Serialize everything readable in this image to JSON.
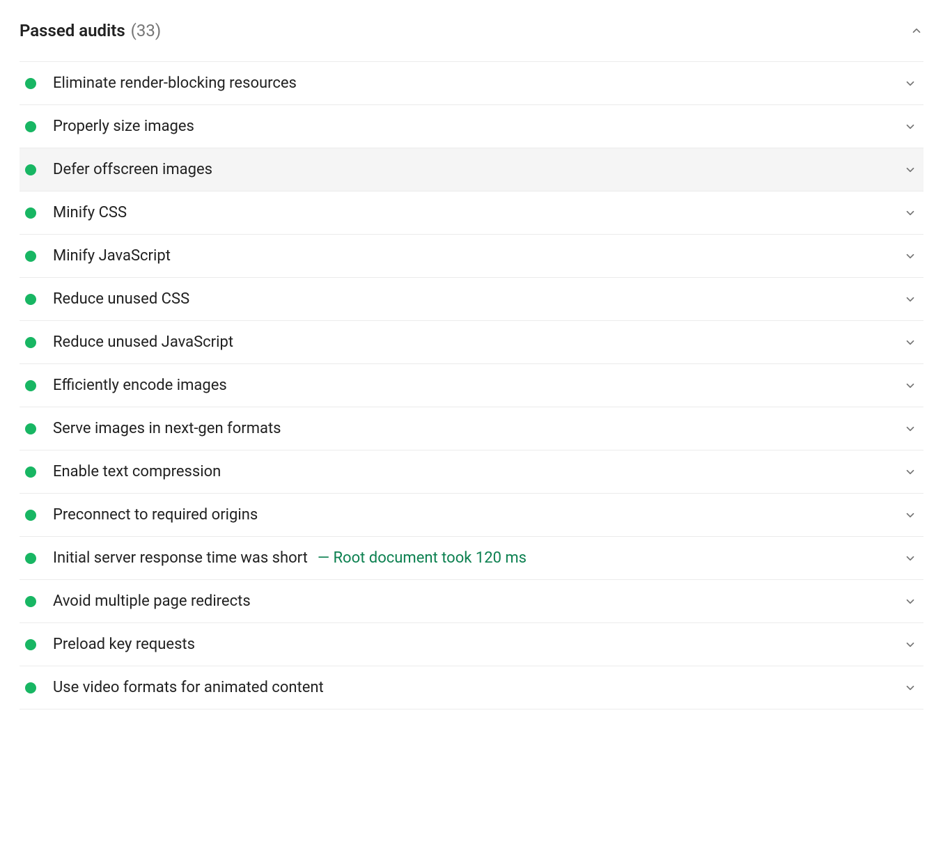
{
  "header": {
    "title": "Passed audits",
    "count": "(33)"
  },
  "audits": [
    {
      "label": "Eliminate render-blocking resources",
      "detail": "",
      "highlighted": false
    },
    {
      "label": "Properly size images",
      "detail": "",
      "highlighted": false
    },
    {
      "label": "Defer offscreen images",
      "detail": "",
      "highlighted": true
    },
    {
      "label": "Minify CSS",
      "detail": "",
      "highlighted": false
    },
    {
      "label": "Minify JavaScript",
      "detail": "",
      "highlighted": false
    },
    {
      "label": "Reduce unused CSS",
      "detail": "",
      "highlighted": false
    },
    {
      "label": "Reduce unused JavaScript",
      "detail": "",
      "highlighted": false
    },
    {
      "label": "Efficiently encode images",
      "detail": "",
      "highlighted": false
    },
    {
      "label": "Serve images in next-gen formats",
      "detail": "",
      "highlighted": false
    },
    {
      "label": "Enable text compression",
      "detail": "",
      "highlighted": false
    },
    {
      "label": "Preconnect to required origins",
      "detail": "",
      "highlighted": false
    },
    {
      "label": "Initial server response time was short",
      "detail": "— Root document took 120 ms",
      "highlighted": false
    },
    {
      "label": "Avoid multiple page redirects",
      "detail": "",
      "highlighted": false
    },
    {
      "label": "Preload key requests",
      "detail": "",
      "highlighted": false
    },
    {
      "label": "Use video formats for animated content",
      "detail": "",
      "highlighted": false
    }
  ],
  "colors": {
    "pass": "#18b663",
    "detail": "#0c8050",
    "muted": "#757575",
    "border": "#ebebeb"
  }
}
